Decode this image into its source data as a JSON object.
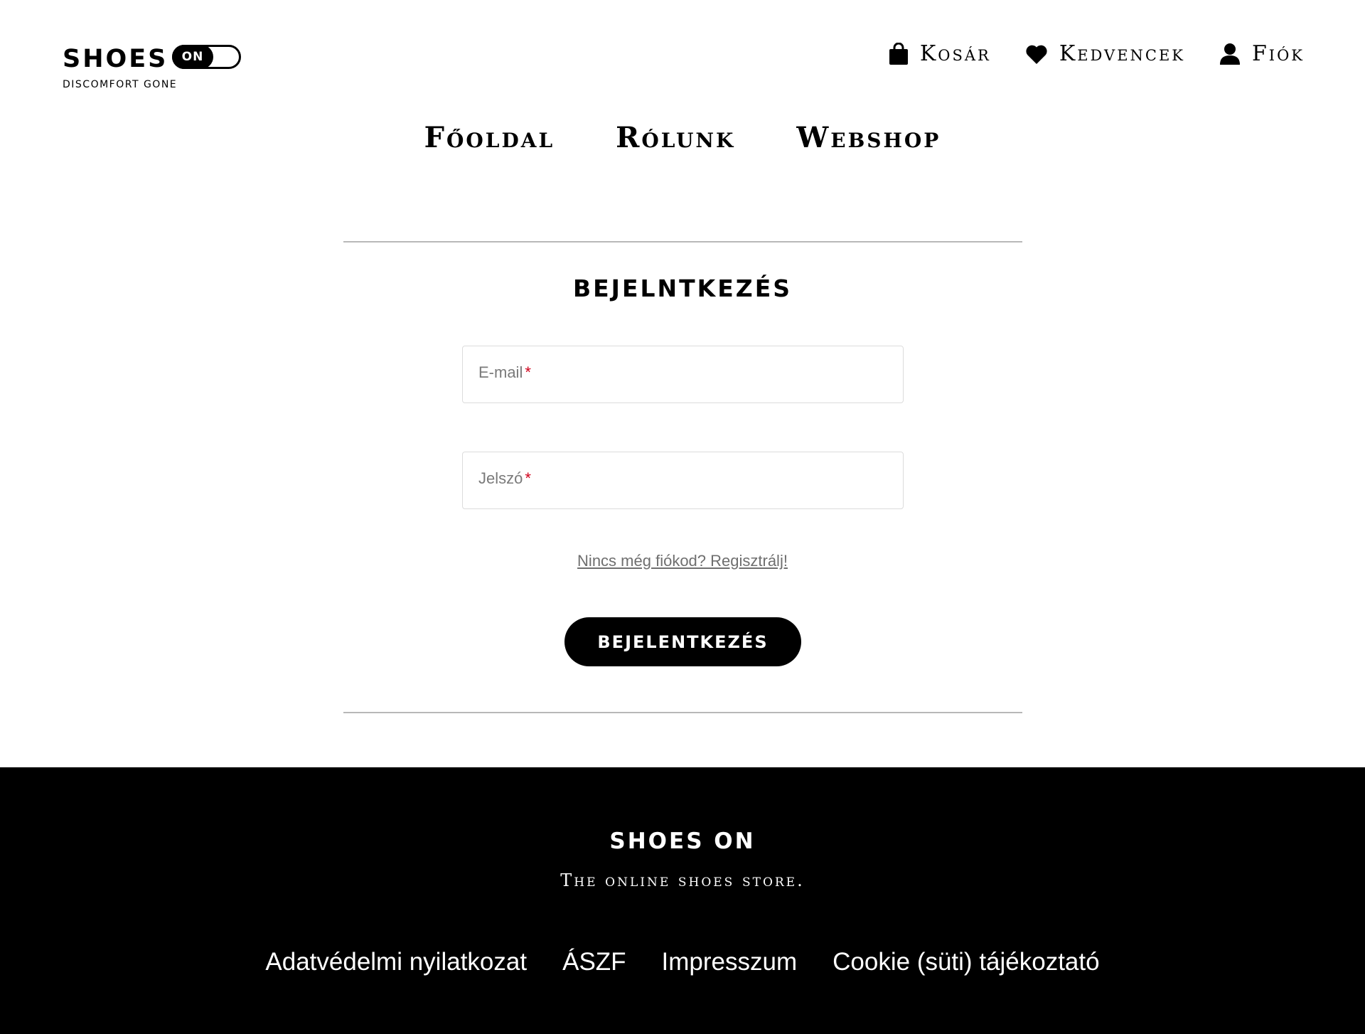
{
  "header": {
    "logo": {
      "wordmark": "SHOES",
      "toggle_label": "ON",
      "tagline": "DISCOMFORT GONE"
    },
    "user_nav": [
      {
        "label": "Kosár",
        "icon": "shopping-bag-icon"
      },
      {
        "label": "Kedvencek",
        "icon": "heart-icon"
      },
      {
        "label": "Fiók",
        "icon": "user-icon"
      }
    ],
    "main_nav": [
      {
        "label": "Főoldal"
      },
      {
        "label": "Rólunk"
      },
      {
        "label": "Webshop"
      }
    ]
  },
  "login": {
    "title": "BEJELNTKEZÉS",
    "email": {
      "label": "E-mail",
      "required_mark": "*",
      "value": ""
    },
    "password": {
      "label": "Jelszó",
      "required_mark": "*",
      "value": ""
    },
    "register_link": "Nincs még fiókod? Regisztrálj!",
    "submit_label": "BEJELENTKEZÉS"
  },
  "footer": {
    "brand": "SHOES ON",
    "slogan": "The online shoes store.",
    "links": [
      {
        "label": "Adatvédelmi nyilatkozat"
      },
      {
        "label": "ÁSZF"
      },
      {
        "label": "Impresszum"
      },
      {
        "label": "Cookie (süti) tájékoztató"
      }
    ]
  },
  "colors": {
    "background": "#ffffff",
    "text": "#000000",
    "footer_background": "#000000",
    "required_mark": "#d0021b",
    "muted_text": "#7a7a7a"
  }
}
